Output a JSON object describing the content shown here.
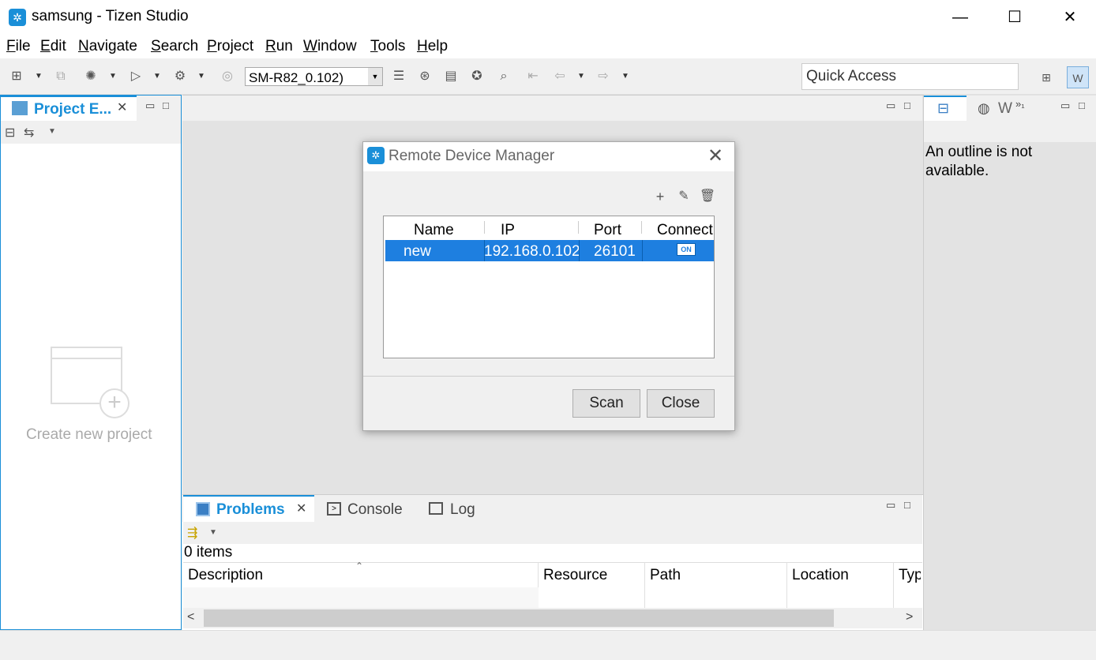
{
  "window": {
    "title": "samsung - Tizen Studio",
    "minimize": "—",
    "maximize": "☐",
    "close": "✕"
  },
  "menu": [
    {
      "label": "File",
      "mnemonic": "F",
      "rest": "ile"
    },
    {
      "label": "Edit",
      "mnemonic": "E",
      "rest": "dit"
    },
    {
      "label": "Navigate",
      "mnemonic": "N",
      "rest": "avigate"
    },
    {
      "label": "Search",
      "mnemonic": "S",
      "rest": "earch"
    },
    {
      "label": "Project",
      "mnemonic": "P",
      "rest": "roject"
    },
    {
      "label": "Run",
      "mnemonic": "R",
      "rest": "un"
    },
    {
      "label": "Window",
      "mnemonic": "W",
      "rest": "indow"
    },
    {
      "label": "Tools",
      "mnemonic": "T",
      "rest": "ools"
    },
    {
      "label": "Help",
      "mnemonic": "H",
      "rest": "elp"
    }
  ],
  "toolbar": {
    "device_selected": "SM-R82_0.102)",
    "quick_access_placeholder": "Quick Access"
  },
  "project_explorer": {
    "tab_label": "Project E...",
    "empty_label": "Create new project"
  },
  "outline": {
    "tab2_label": "W",
    "overflow": "»₁",
    "message": "An outline is not available."
  },
  "bottom": {
    "tabs": {
      "problems": "Problems",
      "console": "Console",
      "log": "Log"
    },
    "items_count": "0 items",
    "columns": [
      "Description",
      "Resource",
      "Path",
      "Location",
      "Typ"
    ]
  },
  "dialog": {
    "title": "Remote Device Manager",
    "columns": [
      "Name",
      "IP",
      "Port",
      "Connect"
    ],
    "rows": [
      {
        "name": "new",
        "ip": "192.168.0.102",
        "port": "26101",
        "connect": "ON"
      }
    ],
    "scan_label": "Scan",
    "close_label": "Close"
  }
}
